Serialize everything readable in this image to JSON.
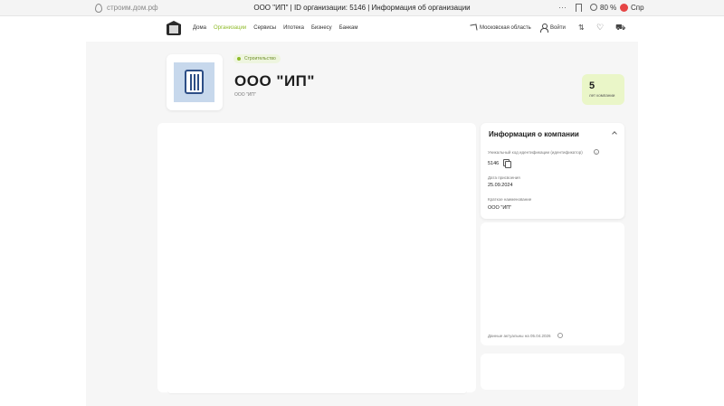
{
  "browser": {
    "url": "строим.дом.рф",
    "tab_title": "ООО \"ИП\" | ID организации: 5146 | Информация об организации",
    "more": "···",
    "zoom": "80 %",
    "reference": "Спр"
  },
  "header": {
    "nav": [
      {
        "label": "Дома",
        "active": false
      },
      {
        "label": "Организации",
        "active": true
      },
      {
        "label": "Сервисы",
        "active": false
      },
      {
        "label": "Ипотека",
        "active": false
      },
      {
        "label": "Бизнесу",
        "active": false
      },
      {
        "label": "Банкам",
        "active": false
      }
    ],
    "region": "Московская область",
    "login": "Войти"
  },
  "company": {
    "tag": "Строительство",
    "name": "ООО \"ИП\"",
    "subtitle": "ООО \"ИП\"",
    "years_value": "5",
    "years_label": "лет компании"
  },
  "info": {
    "title": "Информация о компании",
    "id_label": "Уникальный код идентификации (идентификатор)",
    "id_value": "5146",
    "date_label": "Дата присвоения",
    "date_value": "25.09.2024",
    "short_label": "Краткое наименование",
    "short_value": "ООО \"ИП\""
  },
  "footer_note": "Данные актуальны на 05.04.2026",
  "colors": {
    "accent": "#8fbb2a",
    "years_badge": "#eaf6c8",
    "logo_bg": "#c7d8ec",
    "logo_mark": "#2d4e86"
  }
}
